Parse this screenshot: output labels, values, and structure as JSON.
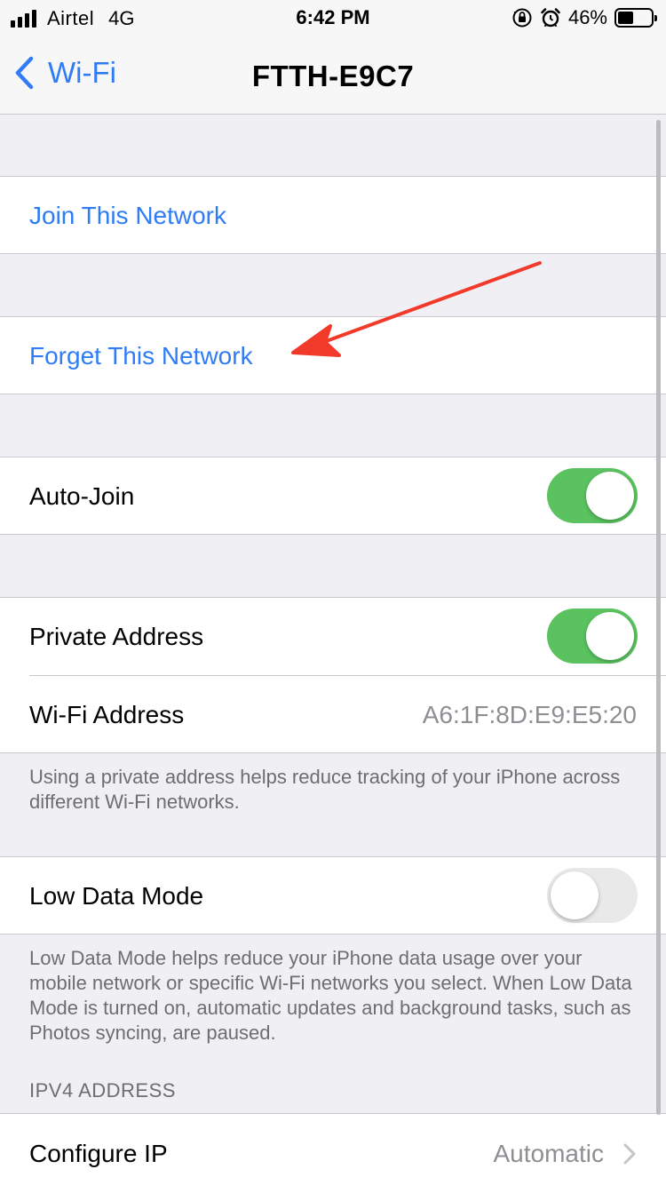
{
  "status_bar": {
    "carrier": "Airtel",
    "network_type": "4G",
    "time": "6:42 PM",
    "battery_percent": "46%",
    "battery_level": 0.46
  },
  "nav": {
    "back_label": "Wi-Fi",
    "title": "FTTH-E9C7"
  },
  "actions": {
    "join": "Join This Network",
    "forget": "Forget This Network"
  },
  "auto_join": {
    "label": "Auto-Join",
    "enabled": true
  },
  "private_address": {
    "label": "Private Address",
    "enabled": true,
    "wifi_address_label": "Wi-Fi Address",
    "wifi_address_value": "A6:1F:8D:E9:E5:20",
    "footer": "Using a private address helps reduce tracking of your iPhone across different Wi-Fi networks."
  },
  "low_data_mode": {
    "label": "Low Data Mode",
    "enabled": false,
    "footer": "Low Data Mode helps reduce your iPhone data usage over your mobile network or specific Wi-Fi networks you select. When Low Data Mode is turned on, automatic updates and background tasks, such as Photos syncing, are paused."
  },
  "ipv4": {
    "section_header": "IPV4 ADDRESS",
    "configure_label": "Configure IP",
    "configure_value": "Automatic"
  },
  "colors": {
    "accent": "#2f7cf6",
    "toggle_on": "#5ac35f",
    "annotation_arrow": "#f23a2a"
  },
  "icons": {
    "back": "chevron-left-icon",
    "disclosure": "chevron-right-icon",
    "signal": "cellular-signal-icon",
    "orientation_lock": "orientation-lock-icon",
    "alarm": "alarm-icon",
    "battery": "battery-icon"
  }
}
